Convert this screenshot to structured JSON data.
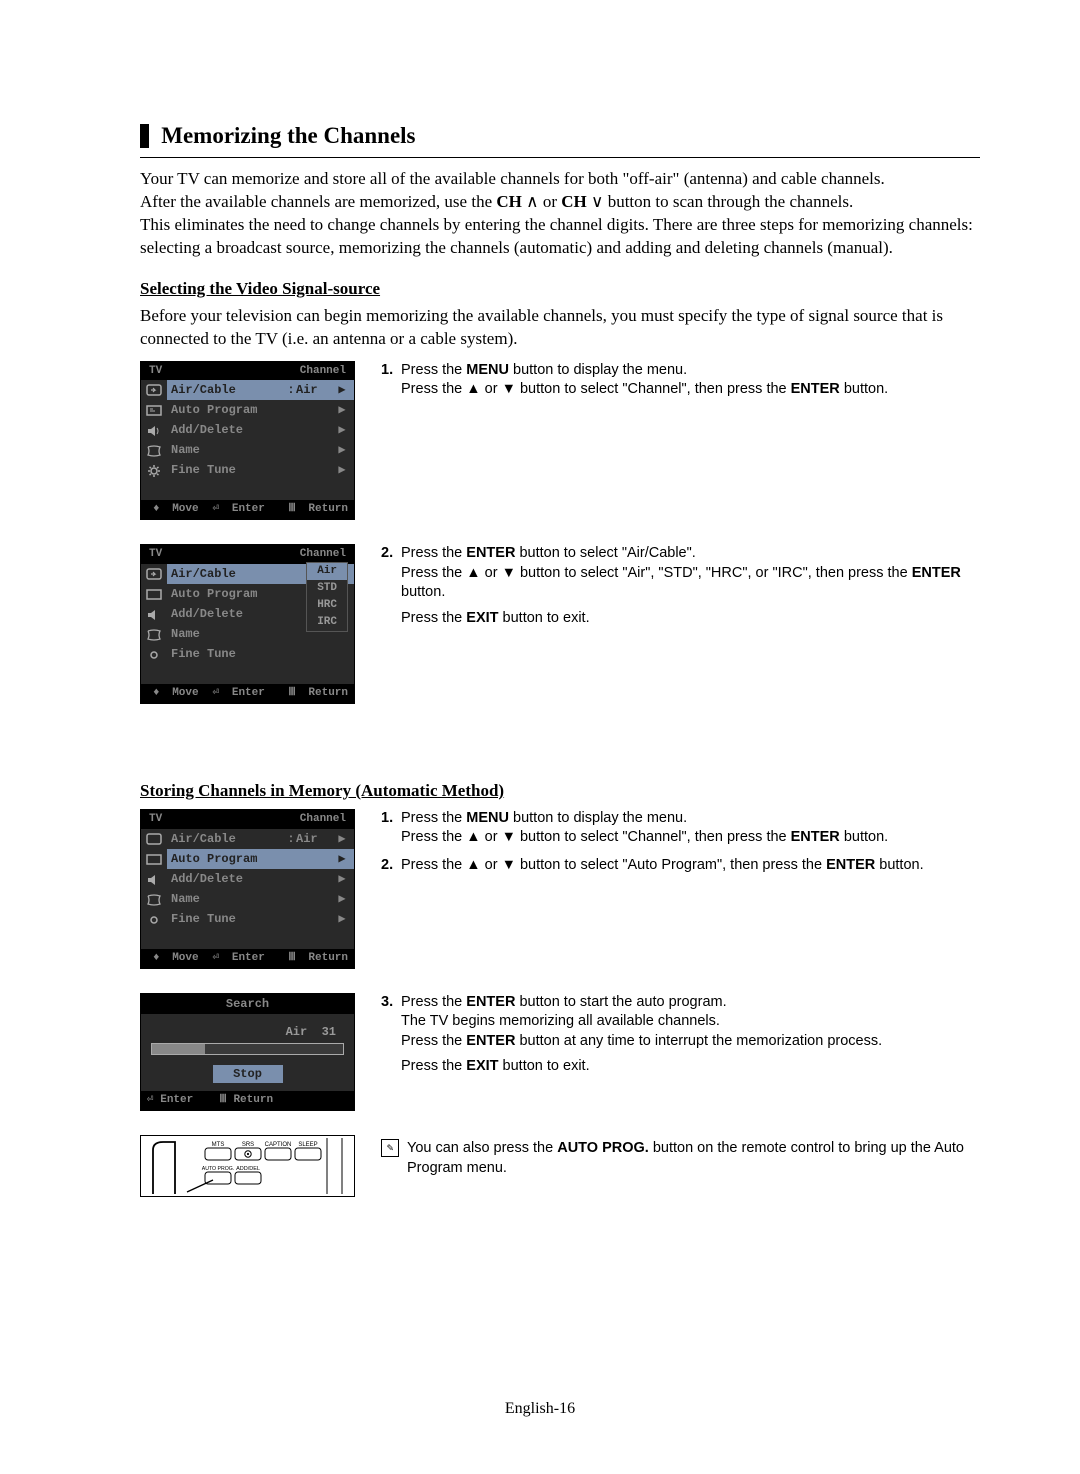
{
  "title": "Memorizing the Channels",
  "intro": [
    "Your TV can memorize and store all of the available channels for both \"off-air\" (antenna) and cable channels.",
    "After the available channels are memorized, use the ",
    "CH",
    " or ",
    "CH",
    " button to scan through the channels.",
    "This eliminates the need to change channels by entering the channel digits. There are three steps for memorizing channels:",
    "selecting a broadcast source, memorizing the channels (automatic) and adding and deleting channels (manual)."
  ],
  "section1": {
    "heading": "Selecting the Video Signal-source",
    "intro": "Before your television can begin memorizing the available channels, you must specify the type of signal source that is connected to the TV (i.e. an antenna or a cable system).",
    "step1": {
      "num": "1.",
      "l1a": "Press the ",
      "l1b": "MENU",
      "l1c": " button to display the menu.",
      "l2a": "Press the ",
      "l2b": " or ",
      "l2c": " button to select \"Channel\", then press the ",
      "l2d": "ENTER",
      "l2e": " button."
    },
    "step2": {
      "num": "2.",
      "l1a": "Press the ",
      "l1b": "ENTER",
      "l1c": " button to select \"Air/Cable\".",
      "l2a": "Press the ",
      "l2b": " or ",
      "l2c": " button to select \"Air\", \"STD\", \"HRC\", or \"IRC\", then press the ",
      "l2d": "ENTER",
      "l2e": " button.",
      "l3a": "Press the ",
      "l3b": "EXIT",
      "l3c": " button to exit."
    }
  },
  "section2": {
    "heading": "Storing Channels in Memory (Automatic Method)",
    "step1": {
      "num": "1.",
      "l1a": "Press the ",
      "l1b": "MENU",
      "l1c": " button to display the menu.",
      "l2a": "Press the ",
      "l2b": " or ",
      "l2c": " button to select \"Channel\", then press the ",
      "l2d": "ENTER",
      "l2e": " button."
    },
    "step2": {
      "num": "2.",
      "l1a": "Press the ",
      "l1b": " or ",
      "l1c": " button to select \"Auto Program\", then press the ",
      "l1d": "ENTER",
      "l1e": " button."
    },
    "step3": {
      "num": "3.",
      "l1a": "Press the ",
      "l1b": "ENTER",
      "l1c": " button to start the auto program.",
      "l2": "The TV begins memorizing all available channels.",
      "l3a": "Press the ",
      "l3b": "ENTER",
      "l3c": " button at any time to interrupt the memorization process.",
      "l4a": "Press the ",
      "l4b": "EXIT",
      "l4c": " button to exit."
    },
    "note": {
      "a": "You can also press the ",
      "b": "AUTO PROG.",
      "c": " button on the remote control to bring up the Auto Program menu."
    }
  },
  "osd": {
    "tv": "TV",
    "channel": "Channel",
    "items": {
      "aircable": "Air/Cable",
      "auto": "Auto Program",
      "adddel": "Add/Delete",
      "name": "Name",
      "finetune": "Fine Tune"
    },
    "air": "Air",
    "popup": [
      "Air",
      "STD",
      "HRC",
      "IRC"
    ],
    "footer": {
      "move": "Move",
      "enter": "Enter",
      "return": "Return"
    },
    "search": {
      "title": "Search",
      "status_a": "Air",
      "status_b": "31",
      "stop": "Stop",
      "enter": "Enter",
      "return": "Return"
    }
  },
  "page_num": "English-16",
  "remote_labels": {
    "mts": "MTS",
    "srs": "SRS",
    "caption": "CAPTION",
    "sleep": "SLEEP",
    "autoprog": "AUTO PROG.",
    "adddel": "ADD/DEL"
  }
}
